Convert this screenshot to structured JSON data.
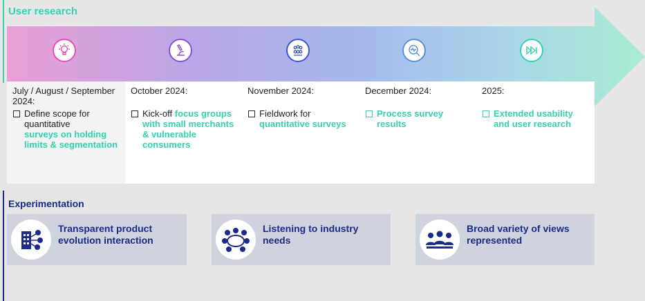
{
  "sections": {
    "user_research": "User research",
    "experimentation": "Experimentation"
  },
  "colors": {
    "accent_green": "#33d1b0",
    "navy": "#1b2a8a",
    "pink": "#e9a8d6",
    "purple": "#9a6fd8",
    "blue": "#6f8fe0"
  },
  "timeline": {
    "stages": [
      {
        "icon": "lightbulb-icon",
        "date": "July / August / September 2024:",
        "prefix": "Define scope for quantitative",
        "highlight": "surveys on holding limits & segmentation",
        "suffix": ""
      },
      {
        "icon": "microscope-icon",
        "date": "October 2024:",
        "prefix": "Kick-off",
        "highlight": "focus groups with small merchants & vulnerable consumers",
        "suffix": ""
      },
      {
        "icon": "group-icon",
        "date": "November 2024:",
        "prefix": "Fieldwork for",
        "highlight": "quantitative surveys",
        "suffix": ""
      },
      {
        "icon": "magnifier-pulse-icon",
        "date": "December 2024:",
        "prefix": "",
        "highlight": "Process survey results",
        "suffix": ""
      },
      {
        "icon": "fast-forward-icon",
        "date": "2025:",
        "prefix": "",
        "highlight": "Extended usability and user research",
        "suffix": ""
      }
    ]
  },
  "cards": [
    {
      "icon": "building-network-icon",
      "label": "Transparent product evolution interaction"
    },
    {
      "icon": "meeting-table-icon",
      "label": "Listening to industry needs"
    },
    {
      "icon": "people-group-icon",
      "label": "Broad variety of views represented"
    }
  ]
}
